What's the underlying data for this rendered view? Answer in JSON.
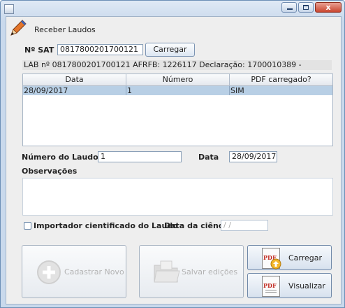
{
  "window": {
    "close_glyph": "x"
  },
  "header": {
    "title": "Receber Laudos",
    "icon": "pen-icon"
  },
  "sat": {
    "label": "Nº SAT",
    "value": "0817800201700121",
    "button_label": "Carregar"
  },
  "info_line": "LAB nº 0817800201700121 AFRFB: 1226117 Declaração: 1700010389 -",
  "table": {
    "columns": [
      "Data",
      "Número",
      "PDF carregado?"
    ],
    "rows": [
      {
        "data": "28/09/2017",
        "numero": "1",
        "pdf": "SIM"
      }
    ],
    "selected_row_color": "#b8cfe5"
  },
  "laudo": {
    "numero_label": "Número do Laudo",
    "numero_value": "1",
    "data_label": "Data",
    "data_value": "28/09/2017"
  },
  "observacoes": {
    "label": "Observações",
    "value": ""
  },
  "importador": {
    "checkbox_label": "Importador cientificado do Laudo",
    "checked": false,
    "ciencia_label": "Data da ciência",
    "ciencia_placeholder": "/ /"
  },
  "actions": {
    "cadastrar": "Cadastrar Novo",
    "salvar": "Salvar edições",
    "carregar": "Carregar",
    "visualizar": "Visualizar"
  },
  "icon_names": [
    "app-icon",
    "minimize-icon",
    "maximize-icon",
    "close-icon",
    "pen-icon",
    "add-icon",
    "folder-icon",
    "pdf-import-icon",
    "pdf-icon"
  ]
}
